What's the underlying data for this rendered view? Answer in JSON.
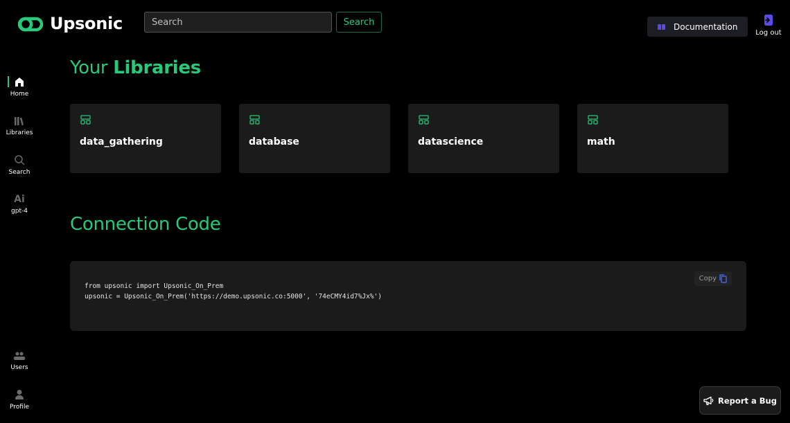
{
  "header": {
    "brand": "Upsonic",
    "search_placeholder": "Search",
    "search_button": "Search",
    "documentation_button": "Documentation",
    "logout_label": "Log out"
  },
  "sidebar": {
    "items": [
      {
        "label": "Home",
        "icon": "home-icon",
        "active": true
      },
      {
        "label": "Libraries",
        "icon": "libraries-icon",
        "active": false
      },
      {
        "label": "Search",
        "icon": "search-icon",
        "active": false
      },
      {
        "label": "gpt-4",
        "icon": "ai-icon",
        "icon_text": "Ai",
        "active": false
      },
      {
        "label": "Users",
        "icon": "users-icon",
        "active": false
      },
      {
        "label": "Profile",
        "icon": "profile-icon",
        "active": false
      }
    ]
  },
  "libraries": {
    "heading_prefix": "Your ",
    "heading_strong": "Libraries",
    "items": [
      {
        "name": "data_gathering"
      },
      {
        "name": "database"
      },
      {
        "name": "datascience"
      },
      {
        "name": "math"
      }
    ]
  },
  "connection": {
    "heading": "Connection Code",
    "code_line_1": "from upsonic import Upsonic_On_Prem",
    "code_line_2": "upsonic = Upsonic_On_Prem('https://demo.upsonic.co:5000', '74eCMY4id7%Jx%')",
    "copy_label": "Copy"
  },
  "report_bug": "Report a Bug",
  "colors": {
    "accent": "#27c97a",
    "background": "#000000",
    "card": "#1b1b1b",
    "doc_icon": "#5b4ae6"
  }
}
